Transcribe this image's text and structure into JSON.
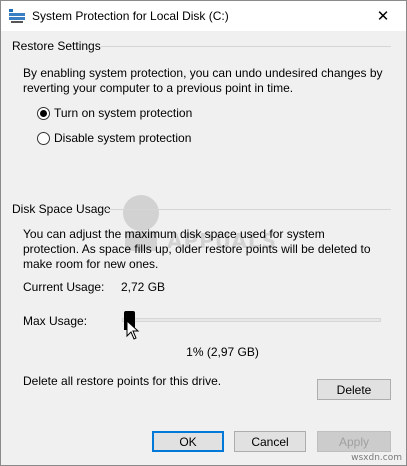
{
  "window": {
    "title": "System Protection for Local Disk (C:)",
    "close_glyph": "✕"
  },
  "restore_settings": {
    "header": "Restore Settings",
    "description": "By enabling system protection, you can undo undesired changes by reverting your computer to a previous point in time.",
    "options": [
      {
        "label": "Turn on system protection",
        "checked": true
      },
      {
        "label": "Disable system protection",
        "checked": false
      }
    ]
  },
  "disk_space": {
    "header": "Disk Space Usage",
    "description": "You can adjust the maximum disk space used for system protection. As space fills up, older restore points will be deleted to make room for new ones.",
    "current_usage_label": "Current Usage:",
    "current_usage_value": "2,72 GB",
    "max_usage_label": "Max Usage:",
    "max_usage_percent": 1,
    "max_usage_text": "1% (2,97 GB)",
    "delete_text": "Delete all restore points for this drive.",
    "delete_button": "Delete"
  },
  "buttons": {
    "ok": "OK",
    "cancel": "Cancel",
    "apply": "Apply"
  },
  "watermark": {
    "text": "APPUALS",
    "footer": "wsxdn.com"
  },
  "colors": {
    "default_button_border": "#0078d7",
    "title_icon": "#1e6fb6"
  }
}
